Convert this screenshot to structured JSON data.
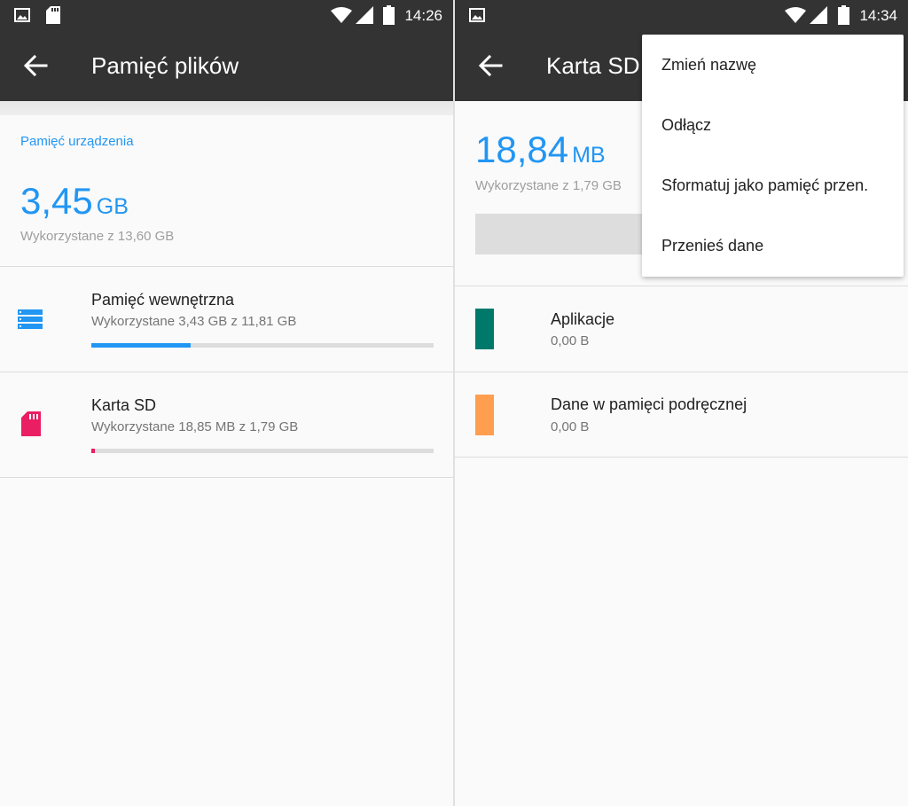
{
  "colors": {
    "statusbar_bg": "#333333",
    "accent": "#2196f3",
    "sd_pink": "#e91e63",
    "apps_teal": "#00796b",
    "cache_orange": "#ff9e4f"
  },
  "left": {
    "status": {
      "time": "14:26",
      "icons": [
        "image-icon",
        "sd-card-icon",
        "wifi-icon",
        "cell-signal-icon",
        "battery-icon"
      ]
    },
    "appbar": {
      "title": "Pamięć plików",
      "back_icon": "arrow-back-icon"
    },
    "device_storage": {
      "label": "Pamięć urządzenia",
      "used_value": "3,45",
      "used_unit": "GB",
      "used_of_total": "Wykorzystane z 13,60 GB"
    },
    "volumes": [
      {
        "icon": "storage-icon",
        "name": "Pamięć wewnętrzna",
        "summary": "Wykorzystane 3,43 GB z 11,81 GB",
        "used_fraction": 0.29,
        "color": "#2196f3"
      },
      {
        "icon": "sd-card-icon",
        "name": "Karta SD",
        "summary": "Wykorzystane 18,85 MB z 1,79 GB",
        "used_fraction": 0.01,
        "color": "#e91e63"
      }
    ]
  },
  "right": {
    "status": {
      "time": "14:34",
      "icons": [
        "image-icon",
        "wifi-icon",
        "cell-signal-icon",
        "battery-icon"
      ]
    },
    "appbar": {
      "title": "Karta SD",
      "back_icon": "arrow-back-icon"
    },
    "summary": {
      "used_value": "18,84",
      "used_unit": "MB",
      "used_of_total": "Wykorzystane z 1,79 GB"
    },
    "categories": [
      {
        "name": "Aplikacje",
        "size": "0,00 B",
        "color": "#00796b"
      },
      {
        "name": "Dane w pamięci podręcznej",
        "size": "0,00 B",
        "color": "#ff9e4f"
      }
    ],
    "overflow_menu": [
      {
        "label": "Zmień nazwę"
      },
      {
        "label": "Odłącz"
      },
      {
        "label": "Sformatuj jako pamięć przen."
      },
      {
        "label": "Przenieś dane"
      }
    ]
  }
}
